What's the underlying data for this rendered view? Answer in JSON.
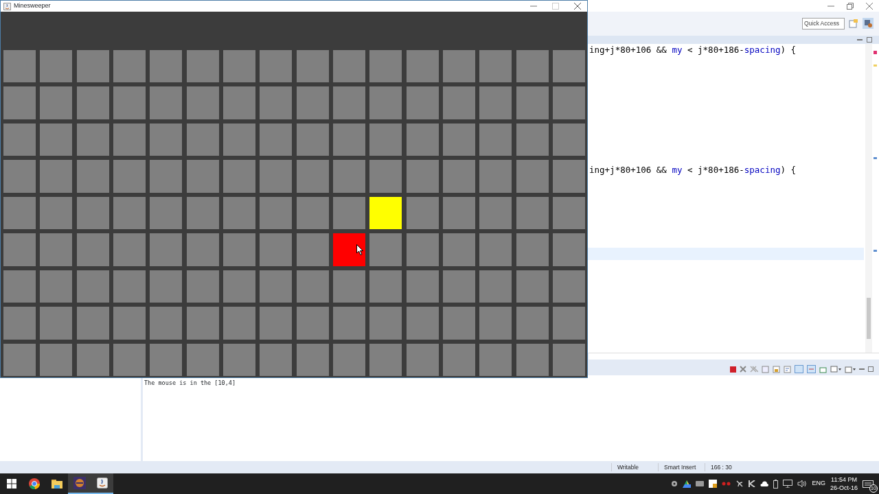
{
  "ide": {
    "quick_access": {
      "placeholder": "Quick Access"
    },
    "editor": {
      "lines": [
        {
          "kind": "code",
          "current": false,
          "segments": [
            {
              "text": "ing+j*80+106 && ",
              "kind": "plain"
            },
            {
              "text": "my",
              "kind": "field"
            },
            {
              "text": " < j*80+186-",
              "kind": "plain"
            },
            {
              "text": "spacing",
              "kind": "field"
            },
            {
              "text": ") {",
              "kind": "plain"
            }
          ]
        },
        {
          "kind": "blank",
          "current": false
        },
        {
          "kind": "blank",
          "current": false
        },
        {
          "kind": "blank",
          "current": false
        },
        {
          "kind": "blank",
          "current": false
        },
        {
          "kind": "blank",
          "current": false
        },
        {
          "kind": "blank",
          "current": false
        },
        {
          "kind": "blank",
          "current": false
        },
        {
          "kind": "blank",
          "current": false
        },
        {
          "kind": "blank",
          "current": false
        },
        {
          "kind": "code",
          "current": false,
          "segments": [
            {
              "text": "ing+j*80+106 && ",
              "kind": "plain"
            },
            {
              "text": "my",
              "kind": "field"
            },
            {
              "text": " < j*80+186-",
              "kind": "plain"
            },
            {
              "text": "spacing",
              "kind": "field"
            },
            {
              "text": ") {",
              "kind": "plain"
            }
          ]
        },
        {
          "kind": "blank",
          "current": false
        },
        {
          "kind": "blank",
          "current": false
        },
        {
          "kind": "blank",
          "current": false
        },
        {
          "kind": "blank",
          "current": false
        },
        {
          "kind": "blank",
          "current": false
        },
        {
          "kind": "blank",
          "current": false
        },
        {
          "kind": "blank",
          "current": true
        }
      ]
    },
    "console": {
      "output": "The mouse is in the [10,4]"
    },
    "status_bar": [
      "Writable",
      "Smart Insert",
      "166 : 30"
    ]
  },
  "minesweeper": {
    "title": "Minesweeper",
    "cells": [
      [
        {
          "kind": "covered"
        },
        {
          "kind": "covered"
        },
        {
          "kind": "covered"
        },
        {
          "kind": "covered"
        },
        {
          "kind": "covered"
        },
        {
          "kind": "covered"
        },
        {
          "kind": "covered"
        },
        {
          "kind": "covered"
        },
        {
          "kind": "covered"
        },
        {
          "kind": "covered"
        },
        {
          "kind": "covered"
        },
        {
          "kind": "covered"
        },
        {
          "kind": "covered"
        },
        {
          "kind": "covered"
        },
        {
          "kind": "covered"
        },
        {
          "kind": "covered"
        }
      ],
      [
        {
          "kind": "covered"
        },
        {
          "kind": "covered"
        },
        {
          "kind": "covered"
        },
        {
          "kind": "covered"
        },
        {
          "kind": "covered"
        },
        {
          "kind": "covered"
        },
        {
          "kind": "covered"
        },
        {
          "kind": "covered"
        },
        {
          "kind": "covered"
        },
        {
          "kind": "covered"
        },
        {
          "kind": "covered"
        },
        {
          "kind": "covered"
        },
        {
          "kind": "covered"
        },
        {
          "kind": "covered"
        },
        {
          "kind": "covered"
        },
        {
          "kind": "covered"
        }
      ],
      [
        {
          "kind": "covered"
        },
        {
          "kind": "covered"
        },
        {
          "kind": "covered"
        },
        {
          "kind": "covered"
        },
        {
          "kind": "covered"
        },
        {
          "kind": "covered"
        },
        {
          "kind": "covered"
        },
        {
          "kind": "covered"
        },
        {
          "kind": "covered"
        },
        {
          "kind": "covered"
        },
        {
          "kind": "covered"
        },
        {
          "kind": "covered"
        },
        {
          "kind": "covered"
        },
        {
          "kind": "covered"
        },
        {
          "kind": "covered"
        },
        {
          "kind": "covered"
        }
      ],
      [
        {
          "kind": "covered"
        },
        {
          "kind": "covered"
        },
        {
          "kind": "covered"
        },
        {
          "kind": "covered"
        },
        {
          "kind": "covered"
        },
        {
          "kind": "covered"
        },
        {
          "kind": "covered"
        },
        {
          "kind": "covered"
        },
        {
          "kind": "covered"
        },
        {
          "kind": "covered"
        },
        {
          "kind": "covered"
        },
        {
          "kind": "covered"
        },
        {
          "kind": "covered"
        },
        {
          "kind": "covered"
        },
        {
          "kind": "covered"
        },
        {
          "kind": "covered"
        }
      ],
      [
        {
          "kind": "covered"
        },
        {
          "kind": "covered"
        },
        {
          "kind": "covered"
        },
        {
          "kind": "covered"
        },
        {
          "kind": "covered"
        },
        {
          "kind": "covered"
        },
        {
          "kind": "covered"
        },
        {
          "kind": "covered"
        },
        {
          "kind": "covered"
        },
        {
          "kind": "covered"
        },
        {
          "kind": "marked"
        },
        {
          "kind": "covered"
        },
        {
          "kind": "covered"
        },
        {
          "kind": "covered"
        },
        {
          "kind": "covered"
        },
        {
          "kind": "covered"
        }
      ],
      [
        {
          "kind": "covered"
        },
        {
          "kind": "covered"
        },
        {
          "kind": "covered"
        },
        {
          "kind": "covered"
        },
        {
          "kind": "covered"
        },
        {
          "kind": "covered"
        },
        {
          "kind": "covered"
        },
        {
          "kind": "covered"
        },
        {
          "kind": "covered"
        },
        {
          "kind": "hovered"
        },
        {
          "kind": "covered"
        },
        {
          "kind": "covered"
        },
        {
          "kind": "covered"
        },
        {
          "kind": "covered"
        },
        {
          "kind": "covered"
        },
        {
          "kind": "covered"
        }
      ],
      [
        {
          "kind": "covered"
        },
        {
          "kind": "covered"
        },
        {
          "kind": "covered"
        },
        {
          "kind": "covered"
        },
        {
          "kind": "covered"
        },
        {
          "kind": "covered"
        },
        {
          "kind": "covered"
        },
        {
          "kind": "covered"
        },
        {
          "kind": "covered"
        },
        {
          "kind": "covered"
        },
        {
          "kind": "covered"
        },
        {
          "kind": "covered"
        },
        {
          "kind": "covered"
        },
        {
          "kind": "covered"
        },
        {
          "kind": "covered"
        },
        {
          "kind": "covered"
        }
      ],
      [
        {
          "kind": "covered"
        },
        {
          "kind": "covered"
        },
        {
          "kind": "covered"
        },
        {
          "kind": "covered"
        },
        {
          "kind": "covered"
        },
        {
          "kind": "covered"
        },
        {
          "kind": "covered"
        },
        {
          "kind": "covered"
        },
        {
          "kind": "covered"
        },
        {
          "kind": "covered"
        },
        {
          "kind": "covered"
        },
        {
          "kind": "covered"
        },
        {
          "kind": "covered"
        },
        {
          "kind": "covered"
        },
        {
          "kind": "covered"
        },
        {
          "kind": "covered"
        }
      ],
      [
        {
          "kind": "covered"
        },
        {
          "kind": "covered"
        },
        {
          "kind": "covered"
        },
        {
          "kind": "covered"
        },
        {
          "kind": "covered"
        },
        {
          "kind": "covered"
        },
        {
          "kind": "covered"
        },
        {
          "kind": "covered"
        },
        {
          "kind": "covered"
        },
        {
          "kind": "covered"
        },
        {
          "kind": "covered"
        },
        {
          "kind": "covered"
        },
        {
          "kind": "covered"
        },
        {
          "kind": "covered"
        },
        {
          "kind": "covered"
        },
        {
          "kind": "covered"
        }
      ]
    ]
  },
  "taskbar": {
    "language": "ENG",
    "time": "11:54 PM",
    "date": "26-Oct-16",
    "notification_count": "10"
  }
}
